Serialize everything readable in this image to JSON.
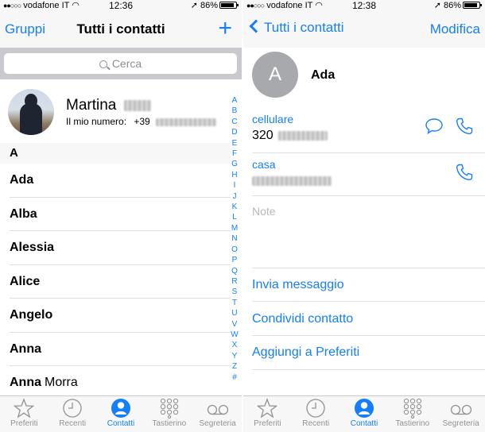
{
  "status_left": {
    "carrier": "vodafone IT",
    "time": "12:36",
    "battery": "86%"
  },
  "status_right": {
    "carrier": "vodafone IT",
    "time": "12:38",
    "battery": "86%"
  },
  "contacts_list": {
    "nav_left": "Gruppi",
    "title": "Tutti i contatti",
    "add": "+",
    "search_placeholder": "Cerca",
    "my_card": {
      "name": "Martina",
      "number_label": "Il mio numero:",
      "number_prefix": "+39"
    },
    "section": "A",
    "contacts": [
      {
        "first": "Ada",
        "last": ""
      },
      {
        "first": "Alba",
        "last": ""
      },
      {
        "first": "Alessia",
        "last": ""
      },
      {
        "first": "Alice",
        "last": ""
      },
      {
        "first": "Angelo",
        "last": ""
      },
      {
        "first": "Anna",
        "last": ""
      },
      {
        "first": "Anna",
        "last": "Morra"
      }
    ],
    "index": [
      "A",
      "B",
      "C",
      "D",
      "E",
      "F",
      "G",
      "H",
      "I",
      "J",
      "K",
      "L",
      "M",
      "N",
      "O",
      "P",
      "Q",
      "R",
      "S",
      "T",
      "U",
      "V",
      "W",
      "X",
      "Y",
      "Z",
      "#"
    ]
  },
  "contact_detail": {
    "back": "Tutti i contatti",
    "edit": "Modifica",
    "initial": "A",
    "name": "Ada",
    "mobile_label": "cellulare",
    "mobile_prefix": "320",
    "home_label": "casa",
    "notes_label": "Note",
    "actions": [
      "Invia messaggio",
      "Condividi contatto",
      "Aggiungi a Preferiti"
    ]
  },
  "tabs": [
    {
      "label": "Preferiti",
      "icon": "star-icon"
    },
    {
      "label": "Recenti",
      "icon": "clock-icon"
    },
    {
      "label": "Contatti",
      "icon": "person-icon"
    },
    {
      "label": "Tastierino",
      "icon": "keypad-icon"
    },
    {
      "label": "Segreteria",
      "icon": "voicemail-icon"
    }
  ],
  "active_tab": "Contatti",
  "colors": {
    "accent": "#147efb",
    "inactive": "#929292",
    "avatar_bg": "#a7a9ad"
  }
}
